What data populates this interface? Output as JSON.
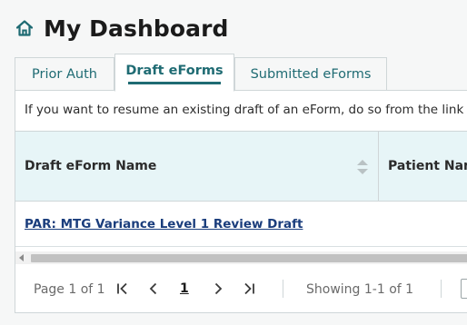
{
  "header": {
    "title": "My Dashboard",
    "home_icon": "home-icon"
  },
  "tabs": [
    {
      "label": "Prior Auth",
      "active": false
    },
    {
      "label": "Draft eForms",
      "active": true
    },
    {
      "label": "Submitted eForms",
      "active": false
    }
  ],
  "panel": {
    "info_text": "If you want to resume an existing draft of an eForm, do so from the link",
    "columns": [
      "Draft eForm Name",
      "Patient Name"
    ],
    "rows": [
      {
        "name": "PAR: MTG Variance Level 1 Review Draft"
      }
    ]
  },
  "pager": {
    "page_info": "Page 1 of 1",
    "current_page": "1",
    "showing": "Showing 1-1 of 1"
  },
  "colors": {
    "accent": "#1f6b73",
    "link": "#1a3d7c",
    "header_bg": "#e7f5f7"
  }
}
